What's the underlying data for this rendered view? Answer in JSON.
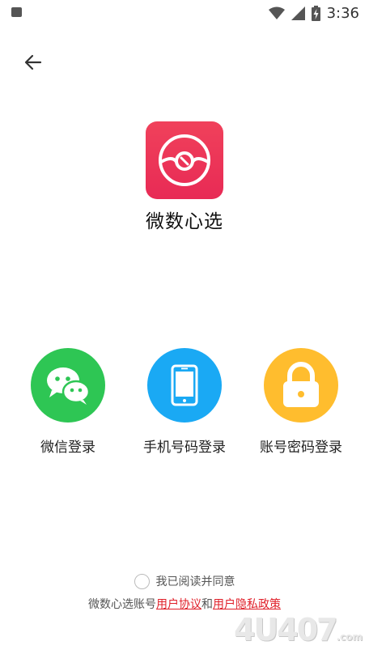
{
  "status_bar": {
    "time": "3:36"
  },
  "app": {
    "name": "微数心选"
  },
  "login_options": [
    {
      "label": "微信登录",
      "icon": "wechat-icon",
      "color": "#2ec654"
    },
    {
      "label": "手机号码登录",
      "icon": "phone-icon",
      "color": "#1aa9f4"
    },
    {
      "label": "账号密码登录",
      "icon": "lock-icon",
      "color": "#ffbd2e"
    }
  ],
  "agreement": {
    "checkbox_label": "我已阅读并同意",
    "prefix": "微数心选账号",
    "user_agreement": "用户协议",
    "conjunction": "和",
    "privacy_policy": "用户隐私政策"
  },
  "watermark": {
    "text": "4U407",
    "suffix": ".com"
  },
  "colors": {
    "brand": "#e82a55",
    "link": "#e0202a"
  }
}
